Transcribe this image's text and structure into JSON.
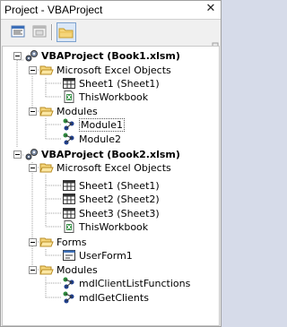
{
  "window": {
    "title": "Project - VBAProject",
    "close_glyph": "✕"
  },
  "toolbar": {
    "buttons": [
      {
        "name": "view-code-button",
        "icon": "code-window-icon"
      },
      {
        "name": "view-object-button",
        "icon": "object-window-icon"
      },
      {
        "name": "toggle-folders-button",
        "icon": "folder-icon",
        "active": true
      }
    ]
  },
  "tree": {
    "projects": [
      {
        "label": "VBAProject (Book1.xlsm)",
        "groups": [
          {
            "label": "Microsoft Excel Objects",
            "items": [
              {
                "label": "Sheet1 (Sheet1)",
                "icon": "worksheet-icon"
              },
              {
                "label": "ThisWorkbook",
                "icon": "workbook-icon"
              }
            ]
          },
          {
            "label": "Modules",
            "items": [
              {
                "label": "Module1",
                "icon": "module-icon",
                "selected": true
              },
              {
                "label": "Module2",
                "icon": "module-icon"
              }
            ]
          }
        ]
      },
      {
        "label": "VBAProject (Book2.xlsm)",
        "groups": [
          {
            "label": "Microsoft Excel Objects",
            "items": [
              {
                "label": "Sheet1 (Sheet1)",
                "icon": "worksheet-icon"
              },
              {
                "label": "Sheet2 (Sheet2)",
                "icon": "worksheet-icon"
              },
              {
                "label": "Sheet3 (Sheet3)",
                "icon": "worksheet-icon"
              },
              {
                "label": "ThisWorkbook",
                "icon": "workbook-icon"
              }
            ]
          },
          {
            "label": "Forms",
            "items": [
              {
                "label": "UserForm1",
                "icon": "userform-icon"
              }
            ]
          },
          {
            "label": "Modules",
            "items": [
              {
                "label": "mdlClientListFunctions",
                "icon": "module-icon"
              },
              {
                "label": "mdlGetClients",
                "icon": "module-icon"
              }
            ]
          }
        ]
      }
    ]
  }
}
